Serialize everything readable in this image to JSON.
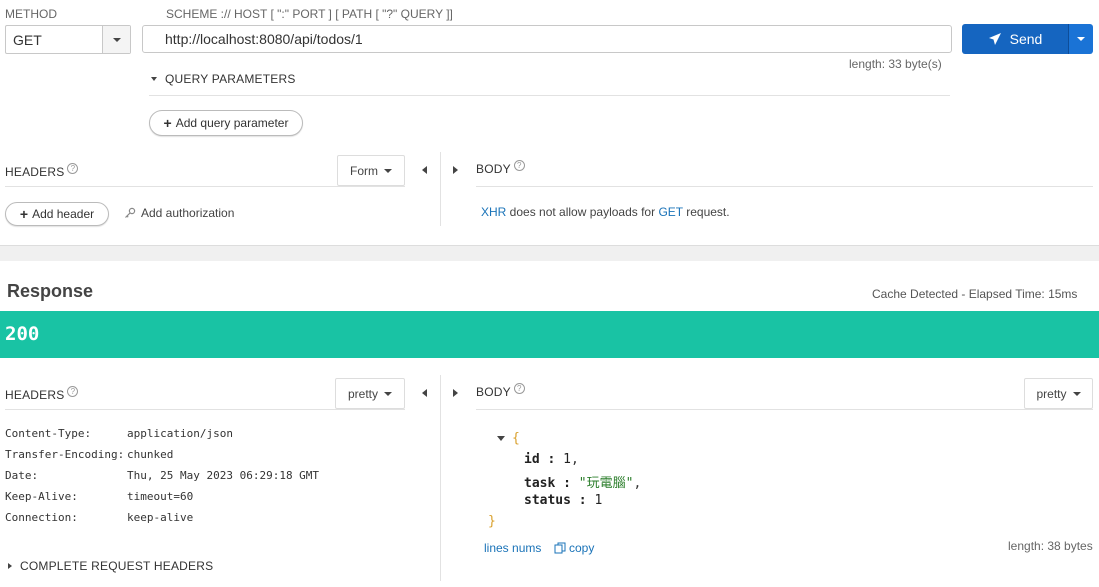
{
  "request": {
    "method_label": "METHOD",
    "method_value": "GET",
    "url_label": "SCHEME :// HOST [ \":\" PORT ] [ PATH [ \"?\" QUERY ]]",
    "url_value": "http://localhost:8080/api/todos/1",
    "length_text": "length: 33 byte(s)",
    "send_label": "Send",
    "query_params_label": "QUERY PARAMETERS",
    "add_query_label": "Add query parameter",
    "headers_label": "HEADERS",
    "form_label": "Form",
    "add_header_label": "Add header",
    "add_auth_label": "Add authorization",
    "body_label": "BODY",
    "body_msg": {
      "xhr": "XHR",
      "middle": " does not allow payloads for ",
      "get": "GET",
      "end": " request."
    }
  },
  "response": {
    "title": "Response",
    "cache_text": "Cache Detected - Elapsed Time: 15ms",
    "status_code": "200",
    "status_color": "#19c3a4",
    "headers_label": "HEADERS",
    "headers_mode": "pretty",
    "body_label": "BODY",
    "body_mode": "pretty",
    "headers": [
      {
        "name": "Content-Type:",
        "value": "application/json"
      },
      {
        "name": "Transfer-Encoding:",
        "value": "chunked"
      },
      {
        "name": "Date:",
        "value": "Thu, 25 May 2023 06:29:18 GMT"
      },
      {
        "name": "Keep-Alive:",
        "value": "timeout=60"
      },
      {
        "name": "Connection:",
        "value": "keep-alive"
      }
    ],
    "complete_headers_label": "COMPLETE REQUEST HEADERS",
    "json": {
      "open": "{",
      "close": "}",
      "fields": [
        {
          "key": "id",
          "value": "1",
          "sep": ","
        },
        {
          "key": "task",
          "value": "\"玩電腦\"",
          "sep": ","
        },
        {
          "key": "status",
          "value": "1",
          "sep": ""
        }
      ]
    },
    "lines_nums_label": "lines nums",
    "copy_label": "copy",
    "body_length": "length: 38 bytes"
  }
}
